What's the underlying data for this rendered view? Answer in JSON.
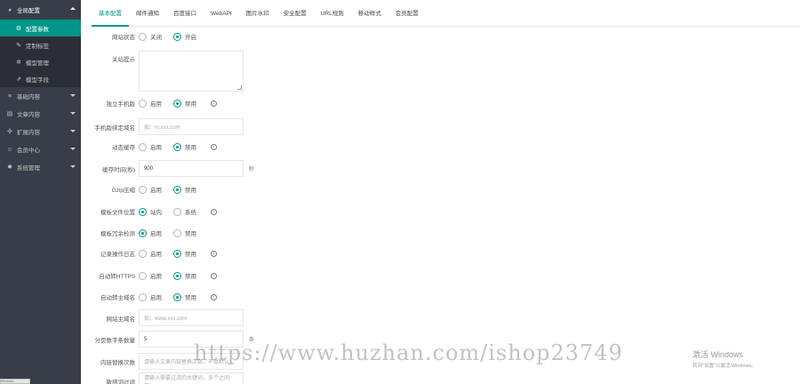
{
  "sidebar": {
    "top": {
      "icon": "dashboard-icon",
      "label": "全局配置"
    },
    "sub": [
      {
        "icon": "sliders-icon",
        "label": "配置参数",
        "active": true
      },
      {
        "icon": "wrench-icon",
        "label": "定制标签",
        "active": false
      },
      {
        "icon": "settings-icon",
        "label": "模型管理",
        "active": false
      },
      {
        "icon": "external-link-icon",
        "label": "模型字段",
        "active": false
      }
    ],
    "groups": [
      {
        "icon": "list-icon",
        "label": "基础内容"
      },
      {
        "icon": "document-icon",
        "label": "文章内容"
      },
      {
        "icon": "puzzle-icon",
        "label": "扩展内容"
      },
      {
        "icon": "user-icon",
        "label": "会员中心"
      },
      {
        "icon": "gear-icon",
        "label": "系统管理"
      }
    ]
  },
  "tabs": [
    {
      "label": "基本配置",
      "active": true
    },
    {
      "label": "邮件通知"
    },
    {
      "label": "百度接口"
    },
    {
      "label": "WebAPI"
    },
    {
      "label": "图片水印"
    },
    {
      "label": "安全配置"
    },
    {
      "label": "URL规则"
    },
    {
      "label": "移动样式"
    },
    {
      "label": "会员配置"
    }
  ],
  "form": {
    "site_status": {
      "label": "网站状态",
      "options": [
        "关闭",
        "开启"
      ],
      "selected": 1
    },
    "close_tip": {
      "label": "关站提示",
      "value": ""
    },
    "mobile_site": {
      "label": "独立手机版",
      "options": [
        "启用",
        "禁用"
      ],
      "selected": 1,
      "tip": "i"
    },
    "mobile_domain": {
      "label": "手机版绑定域名",
      "placeholder": "如：m.xxx.com"
    },
    "dynamic_cache": {
      "label": "动态缓存",
      "options": [
        "启用",
        "禁用"
      ],
      "selected": 1,
      "tip": "i"
    },
    "cache_time": {
      "label": "缓存时间(秒)",
      "value": "900",
      "unit": "秒"
    },
    "gzip": {
      "label": "Gzip压缩",
      "options": [
        "启用",
        "禁用"
      ],
      "selected": 1
    },
    "template_location": {
      "label": "模板文件位置",
      "options": [
        "站内",
        "系统"
      ],
      "selected": 0,
      "tip": "i"
    },
    "fault_tolerance": {
      "label": "模板冗余检测",
      "options": [
        "启用",
        "禁用"
      ],
      "selected": 0
    },
    "record_log": {
      "label": "记录操作日志",
      "options": [
        "启用",
        "禁用"
      ],
      "selected": 1,
      "tip": "i"
    },
    "auto_https": {
      "label": "自动转HTTPS",
      "options": [
        "启用",
        "禁用"
      ],
      "selected": 1,
      "tip": "i"
    },
    "auto_main_domain": {
      "label": "自动转主域名",
      "options": [
        "启用",
        "禁用"
      ],
      "selected": 1,
      "tip": "i"
    },
    "main_domain": {
      "label": "网站主域名",
      "placeholder": "如：www.xxx.com"
    },
    "page_digits": {
      "label": "分页数字条数量",
      "value": "5",
      "unit": "条"
    },
    "replace_count": {
      "label": "内链替换次数",
      "placeholder": "请输入文章内链替换次数，不填默认..."
    },
    "sensitive_words": {
      "label": "敏感词过滤",
      "placeholder": "请输入需要过滤的关键词，多个之间用..."
    }
  },
  "watermark": "https://www.huzhan.com/ishop23749",
  "windows_activation": {
    "title": "激活 Windows",
    "subtitle": "转到\"设置\"以激活 Windows。"
  },
  "bottom_chip": "Windows ..."
}
